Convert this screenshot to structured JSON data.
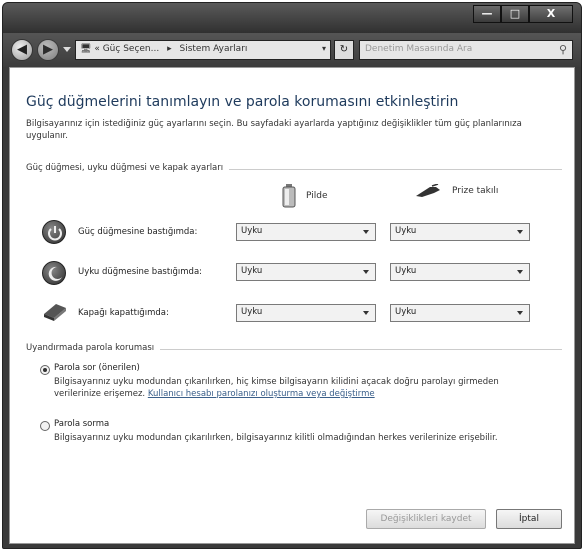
{
  "window": {
    "minimize_label": "—",
    "maximize_label": "□",
    "close_label": "X"
  },
  "nav": {
    "back_label": "◀",
    "forward_label": "▶",
    "address_chevron": "«",
    "breadcrumbs": [
      "Güç Seçen...",
      "Sistem Ayarları"
    ],
    "crumb_separator": "▸",
    "address_dropdown": "▾",
    "refresh_label": "↻",
    "search_placeholder": "Denetim Masasında Ara",
    "search_icon": "⚲"
  },
  "page": {
    "title": "Güç düğmelerini tanımlayın ve parola korumasını etkinleştirin",
    "intro": "Bilgisayarınız için istediğiniz güç ayarlarını seçin. Bu sayfadaki ayarlarda yaptığınız değişiklikler tüm güç planlarınıza uygulanır."
  },
  "power_section": {
    "label": "Güç düğmesi, uyku düğmesi ve kapak ayarları",
    "col_battery": "Pilde",
    "col_plugged": "Prize takılı",
    "rows": [
      {
        "label": "Güç düğmesine bastığımda:",
        "battery": "Uyku",
        "plugged": "Uyku",
        "icon": "power-icon"
      },
      {
        "label": "Uyku düğmesine bastığımda:",
        "battery": "Uyku",
        "plugged": "Uyku",
        "icon": "sleep-moon-icon"
      },
      {
        "label": "Kapağı kapattığımda:",
        "battery": "Uyku",
        "plugged": "Uyku",
        "icon": "laptop-lid-icon"
      }
    ]
  },
  "password_section": {
    "label": "Uyandırmada parola koruması",
    "options": [
      {
        "label": "Parola sor (önerilen)",
        "checked": true,
        "desc": "Bilgisayarınız uyku modundan çıkarılırken, hiç kimse bilgisayarın kilidini açacak doğru parolayı girmeden verilerinize erişemez.",
        "link": "Kullanıcı hesabı parolanızı oluşturma veya değiştirme"
      },
      {
        "label": "Parola sorma",
        "checked": false,
        "desc": "Bilgisayarınız uyku modundan çıkarılırken, bilgisayarınız kilitli olmadığından herkes verilerinize erişebilir."
      }
    ]
  },
  "footer": {
    "save_label": "Değişiklikleri kaydet",
    "cancel_label": "İptal"
  }
}
